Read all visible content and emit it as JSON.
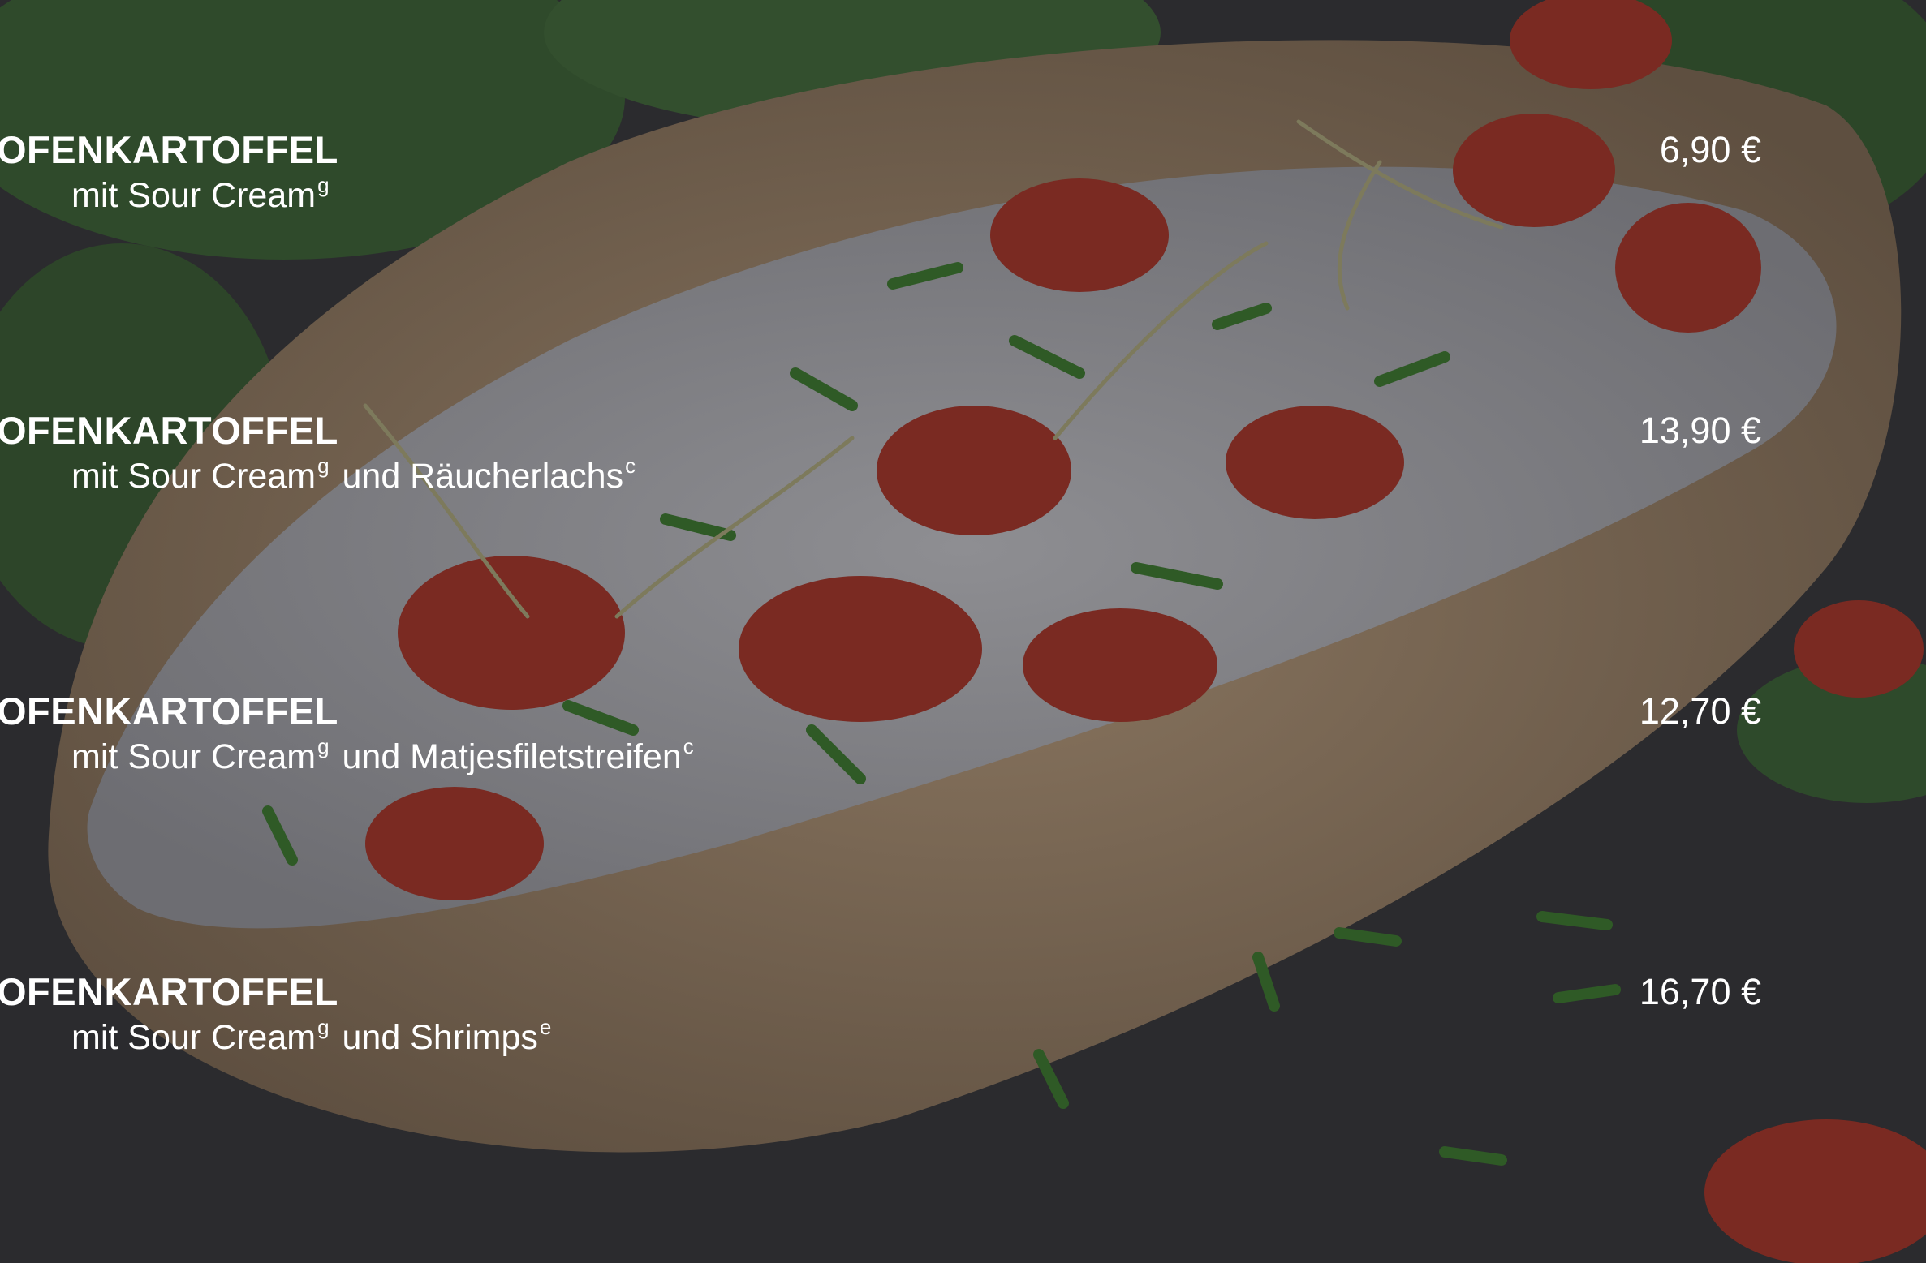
{
  "menu": {
    "items": [
      {
        "title": "OFENKARTOFFEL",
        "desc_main": "mit Sour Cream",
        "desc_sup1": "g",
        "desc_rest": "",
        "desc_sup2": "",
        "price": "6,90 €"
      },
      {
        "title": "OFENKARTOFFEL",
        "desc_main": "mit Sour Cream",
        "desc_sup1": "g",
        "desc_rest": "und Räucherlachs",
        "desc_sup2": "c",
        "price": "13,90 €"
      },
      {
        "title": "OFENKARTOFFEL",
        "desc_main": "mit Sour Cream",
        "desc_sup1": "g",
        "desc_rest": "und Matjesfiletstreifen",
        "desc_sup2": "c",
        "price": "12,70 €"
      },
      {
        "title": "OFENKARTOFFEL",
        "desc_main": "mit Sour Cream",
        "desc_sup1": "g",
        "desc_rest": "und Shrimps",
        "desc_sup2": "e",
        "price": "16,70 €"
      }
    ]
  },
  "colors": {
    "text": "#ffffff",
    "background": "#2a2a2c"
  }
}
